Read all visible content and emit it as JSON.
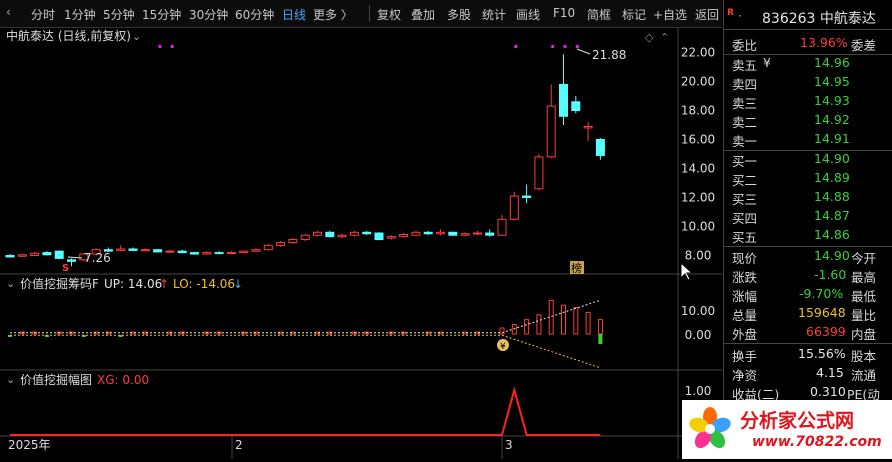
{
  "toolbar": {
    "back_icon": "back-arrow-icon",
    "items": [
      "分时",
      "1分钟",
      "5分钟",
      "15分钟",
      "30分钟",
      "60分钟",
      "日线",
      "更多 〉",
      "复权",
      "叠加",
      "多股",
      "统计",
      "画线",
      "F10",
      "简框",
      "标记",
      "+自选",
      "返回"
    ],
    "active": "日线"
  },
  "main": {
    "title": "中航泰达 (日线,前复权)",
    "high_label": "21.88",
    "low_label": "7.26",
    "marker_s": "S",
    "marker_bang": "榜",
    "y_ticks": [
      "22.00",
      "20.00",
      "18.00",
      "16.00",
      "14.00",
      "12.00",
      "10.00",
      "8.00"
    ],
    "y_values": [
      22,
      20,
      18,
      16,
      14,
      12,
      10,
      8
    ],
    "ylim": [
      7,
      23
    ]
  },
  "indicator1": {
    "name": "价值挖掘筹码F",
    "up_label": "UP: 14.06",
    "lo_label": "LO: -14.06",
    "y_ticks": [
      "10.00",
      "0.00"
    ],
    "marker": "¥"
  },
  "indicator2": {
    "name": "价值挖掘幅图",
    "xg_label": "XG: 0.00",
    "y_ticks": [
      "1.00"
    ]
  },
  "xaxis": {
    "labels": [
      "2025年",
      "2",
      "3"
    ]
  },
  "colors": {
    "up": "#ff3b3b",
    "down": "#54ffff",
    "grid": "#2a2a2a",
    "magenta": "#e020e0"
  },
  "quote": {
    "badge": "R",
    "code_name": "836263 中航泰达",
    "weibi_label": "委比",
    "weibi_value": "13.96%",
    "weicha_label": "委差",
    "asks": [
      {
        "label": "卖五",
        "mark": "¥",
        "price": "14.96"
      },
      {
        "label": "卖四",
        "mark": "",
        "price": "14.95"
      },
      {
        "label": "卖三",
        "mark": "",
        "price": "14.93"
      },
      {
        "label": "卖二",
        "mark": "",
        "price": "14.92"
      },
      {
        "label": "卖一",
        "mark": "",
        "price": "14.91"
      }
    ],
    "bids": [
      {
        "label": "买一",
        "price": "14.90"
      },
      {
        "label": "买二",
        "price": "14.89"
      },
      {
        "label": "买三",
        "price": "14.88"
      },
      {
        "label": "买四",
        "price": "14.87"
      },
      {
        "label": "买五",
        "price": "14.86"
      }
    ],
    "stats": [
      {
        "l1": "现价",
        "v1": "14.90",
        "c1": "green",
        "l2": "今开"
      },
      {
        "l1": "涨跌",
        "v1": "-1.60",
        "c1": "green",
        "l2": "最高"
      },
      {
        "l1": "涨幅",
        "v1": "-9.70%",
        "c1": "green",
        "l2": "最低"
      },
      {
        "l1": "总量",
        "v1": "159648",
        "c1": "yellow",
        "l2": "量比"
      },
      {
        "l1": "外盘",
        "v1": "66399",
        "c1": "red",
        "l2": "内盘"
      }
    ],
    "fin": [
      {
        "l1": "换手",
        "v1": "15.56%",
        "l2": "股本"
      },
      {
        "l1": "净资",
        "v1": "4.15",
        "l2": "流通"
      },
      {
        "l1": "收益(二)",
        "v1": "0.310",
        "l2": "PE(动"
      }
    ]
  },
  "watermark": {
    "text1": "分析家公式网",
    "text2": "www.70822.com"
  },
  "chart_data": {
    "type": "candlestick",
    "title": "中航泰达 (日线,前复权)",
    "ylim": [
      7,
      23
    ],
    "candles": [
      {
        "o": 8.0,
        "c": 7.9,
        "h": 8.1,
        "l": 7.85
      },
      {
        "o": 7.95,
        "c": 8.05,
        "h": 8.1,
        "l": 7.9
      },
      {
        "o": 8.0,
        "c": 8.15,
        "h": 8.25,
        "l": 7.95
      },
      {
        "o": 8.2,
        "c": 8.05,
        "h": 8.3,
        "l": 8.0
      },
      {
        "o": 8.3,
        "c": 7.8,
        "h": 8.35,
        "l": 7.75
      },
      {
        "o": 7.7,
        "c": 7.6,
        "h": 7.8,
        "l": 7.26
      },
      {
        "o": 7.7,
        "c": 8.1,
        "h": 8.2,
        "l": 7.6
      },
      {
        "o": 8.1,
        "c": 8.4,
        "h": 8.5,
        "l": 8.0
      },
      {
        "o": 8.4,
        "c": 8.3,
        "h": 8.55,
        "l": 8.25
      },
      {
        "o": 8.35,
        "c": 8.45,
        "h": 8.7,
        "l": 8.3
      },
      {
        "o": 8.45,
        "c": 8.35,
        "h": 8.55,
        "l": 8.3
      },
      {
        "o": 8.35,
        "c": 8.4,
        "h": 8.5,
        "l": 8.3
      },
      {
        "o": 8.4,
        "c": 8.25,
        "h": 8.45,
        "l": 8.2
      },
      {
        "o": 8.25,
        "c": 8.3,
        "h": 8.4,
        "l": 8.15
      },
      {
        "o": 8.3,
        "c": 8.2,
        "h": 8.4,
        "l": 8.15
      },
      {
        "o": 8.2,
        "c": 8.1,
        "h": 8.25,
        "l": 8.05
      },
      {
        "o": 8.1,
        "c": 8.2,
        "h": 8.3,
        "l": 8.05
      },
      {
        "o": 8.2,
        "c": 8.15,
        "h": 8.3,
        "l": 8.1
      },
      {
        "o": 8.15,
        "c": 8.2,
        "h": 8.3,
        "l": 8.1
      },
      {
        "o": 8.2,
        "c": 8.3,
        "h": 8.35,
        "l": 8.15
      },
      {
        "o": 8.3,
        "c": 8.4,
        "h": 8.5,
        "l": 8.25
      },
      {
        "o": 8.4,
        "c": 8.7,
        "h": 8.8,
        "l": 8.35
      },
      {
        "o": 8.7,
        "c": 8.9,
        "h": 9.0,
        "l": 8.6
      },
      {
        "o": 8.9,
        "c": 9.1,
        "h": 9.2,
        "l": 8.8
      },
      {
        "o": 9.1,
        "c": 9.4,
        "h": 9.5,
        "l": 9.0
      },
      {
        "o": 9.4,
        "c": 9.6,
        "h": 9.7,
        "l": 9.3
      },
      {
        "o": 9.6,
        "c": 9.3,
        "h": 9.7,
        "l": 9.25
      },
      {
        "o": 9.3,
        "c": 9.4,
        "h": 9.5,
        "l": 9.2
      },
      {
        "o": 9.4,
        "c": 9.6,
        "h": 9.7,
        "l": 9.3
      },
      {
        "o": 9.6,
        "c": 9.5,
        "h": 9.7,
        "l": 9.4
      },
      {
        "o": 9.55,
        "c": 9.1,
        "h": 9.6,
        "l": 9.05
      },
      {
        "o": 9.2,
        "c": 9.3,
        "h": 9.4,
        "l": 9.1
      },
      {
        "o": 9.3,
        "c": 9.45,
        "h": 9.55,
        "l": 9.25
      },
      {
        "o": 9.4,
        "c": 9.6,
        "h": 9.7,
        "l": 9.35
      },
      {
        "o": 9.6,
        "c": 9.5,
        "h": 9.7,
        "l": 9.4
      },
      {
        "o": 9.5,
        "c": 9.6,
        "h": 9.8,
        "l": 9.4
      },
      {
        "o": 9.6,
        "c": 9.4,
        "h": 9.65,
        "l": 9.35
      },
      {
        "o": 9.4,
        "c": 9.5,
        "h": 9.6,
        "l": 9.35
      },
      {
        "o": 9.5,
        "c": 9.55,
        "h": 9.7,
        "l": 9.4
      },
      {
        "o": 9.55,
        "c": 9.4,
        "h": 9.8,
        "l": 9.3
      },
      {
        "o": 9.4,
        "c": 10.5,
        "h": 10.8,
        "l": 9.35
      },
      {
        "o": 10.5,
        "c": 12.1,
        "h": 12.4,
        "l": 10.4
      },
      {
        "o": 12.1,
        "c": 12.0,
        "h": 12.9,
        "l": 11.6
      },
      {
        "o": 12.6,
        "c": 14.8,
        "h": 15.0,
        "l": 12.5
      },
      {
        "o": 14.8,
        "c": 18.3,
        "h": 19.8,
        "l": 14.7
      },
      {
        "o": 19.8,
        "c": 17.6,
        "h": 21.88,
        "l": 17.0
      },
      {
        "o": 18.6,
        "c": 18.0,
        "h": 19.0,
        "l": 17.8
      },
      {
        "o": 16.8,
        "c": 16.9,
        "h": 17.2,
        "l": 15.9
      },
      {
        "o": 16.0,
        "c": 14.9,
        "h": 16.1,
        "l": 14.6
      }
    ],
    "xg_peak_index": 41
  }
}
